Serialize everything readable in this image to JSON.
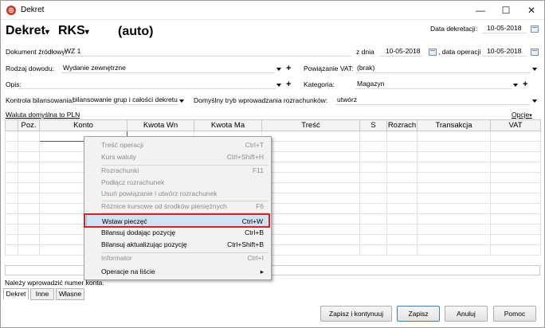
{
  "window": {
    "title": "Dekret"
  },
  "header": {
    "doc_type": "Dekret",
    "doc_kind": "RKS",
    "number": "(auto)",
    "data_dekretacji_label": "Data dekretacji:",
    "data_dekretacji": "10-05-2018"
  },
  "form": {
    "dokument_zrodlowy_label": "Dokument źródłowy:",
    "dokument_zrodlowy": "WZ 1",
    "z_dnia_label": "z dnia",
    "z_dnia": "10-05-2018",
    "data_operacji_label": ", data operacji",
    "data_operacji": "10-05-2018",
    "rodzaj_dowodu_label": "Rodzaj dowodu:",
    "rodzaj_dowodu": "Wydanie zewnętrzne",
    "powiazanie_vat_label": "Powiązanie VAT:",
    "powiazanie_vat": "(brak)",
    "opis_label": "Opis:",
    "opis": "",
    "kategoria_label": "Kategoria:",
    "kategoria": "Magazyn",
    "kontrola_label": "Kontrola bilansowania:",
    "kontrola": "bilansowanie grup i całości dekretu",
    "tryb_label": "Domyślny tryb wprowadzania rozrachunków:",
    "tryb": "utwórz",
    "waluta_link": "Waluta domyślna to PLN",
    "opcje": "Opcje"
  },
  "table": {
    "columns": [
      "",
      "Poz.",
      "Konto",
      "Kwota Wn",
      "Kwota Ma",
      "Treść",
      "S",
      "Rozrach",
      "Transakcja",
      "VAT"
    ]
  },
  "status": {
    "message": "Należy wprowadzić numer konta."
  },
  "tabs": [
    "Dekret",
    "Inne",
    "Własne"
  ],
  "buttons": {
    "zapisz_kontynuuj": "Zapisz i kontynuuj",
    "zapisz": "Zapisz",
    "anuluj": "Anuluj",
    "pomoc": "Pomoc"
  },
  "context_menu": {
    "items": [
      {
        "label": "Treść operacji",
        "shortcut": "Ctrl+T",
        "disabled": true
      },
      {
        "label": "Kurs waluty",
        "shortcut": "Ctrl+Shift+H",
        "disabled": true
      },
      {
        "label": "Rozrachunki",
        "shortcut": "F11",
        "disabled": true
      },
      {
        "label": "Podłącz rozrachunek",
        "shortcut": "",
        "disabled": true
      },
      {
        "label": "Usuń powiązanie i utwórz rozrachunek",
        "shortcut": "",
        "disabled": true
      },
      {
        "label": "Różnice kursowe od środków pieniężnych",
        "shortcut": "F6",
        "disabled": true
      },
      {
        "label": "Wstaw pieczęć",
        "shortcut": "Ctrl+W",
        "disabled": false
      },
      {
        "label": "Bilansuj dodając pozycję",
        "shortcut": "Ctrl+B",
        "disabled": false
      },
      {
        "label": "Bilansuj aktualizując pozycję",
        "shortcut": "Ctrl+Shift+B",
        "disabled": false
      },
      {
        "label": "Informator",
        "shortcut": "Ctrl+I",
        "disabled": true
      },
      {
        "label": "Operacje na liście",
        "shortcut": "",
        "disabled": false
      }
    ]
  },
  "colors": {
    "highlight_border": "#d9202a",
    "menu_highlight": "#cfe3f5"
  }
}
